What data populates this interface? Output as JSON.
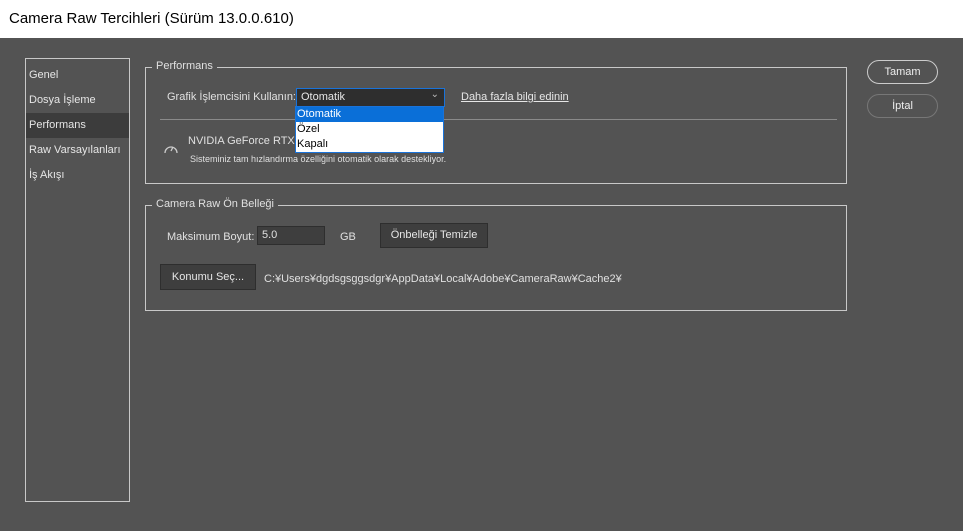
{
  "window": {
    "title": "Camera Raw Tercihleri  (Sürüm 13.0.0.610)"
  },
  "sidebar": {
    "items": [
      {
        "label": "Genel"
      },
      {
        "label": "Dosya İşleme"
      },
      {
        "label": "Performans"
      },
      {
        "label": "Raw Varsayılanları"
      },
      {
        "label": "İş Akışı"
      }
    ]
  },
  "performance": {
    "legend": "Performans",
    "gpu_label": "Grafik İşlemcisini Kullanın:",
    "gpu_value": "Otomatik",
    "options": [
      "Otomatik",
      "Özel",
      "Kapalı"
    ],
    "learn_more": "Daha fazla bilgi edinin",
    "gpu_name": "NVIDIA GeForce RTX 2",
    "gpu_status": "Sisteminiz tam hızlandırma özelliğini otomatik olarak destekliyor."
  },
  "cache": {
    "legend": "Camera Raw Ön Belleği",
    "max_label": "Maksimum Boyut:",
    "max_value": "5.0",
    "unit": "GB",
    "purge": "Önbelleği Temizle",
    "choose": "Konumu Seç...",
    "path": "C:¥Users¥dgdsgsggsdgr¥AppData¥Local¥Adobe¥CameraRaw¥Cache2¥"
  },
  "buttons": {
    "ok": "Tamam",
    "cancel": "İptal"
  }
}
